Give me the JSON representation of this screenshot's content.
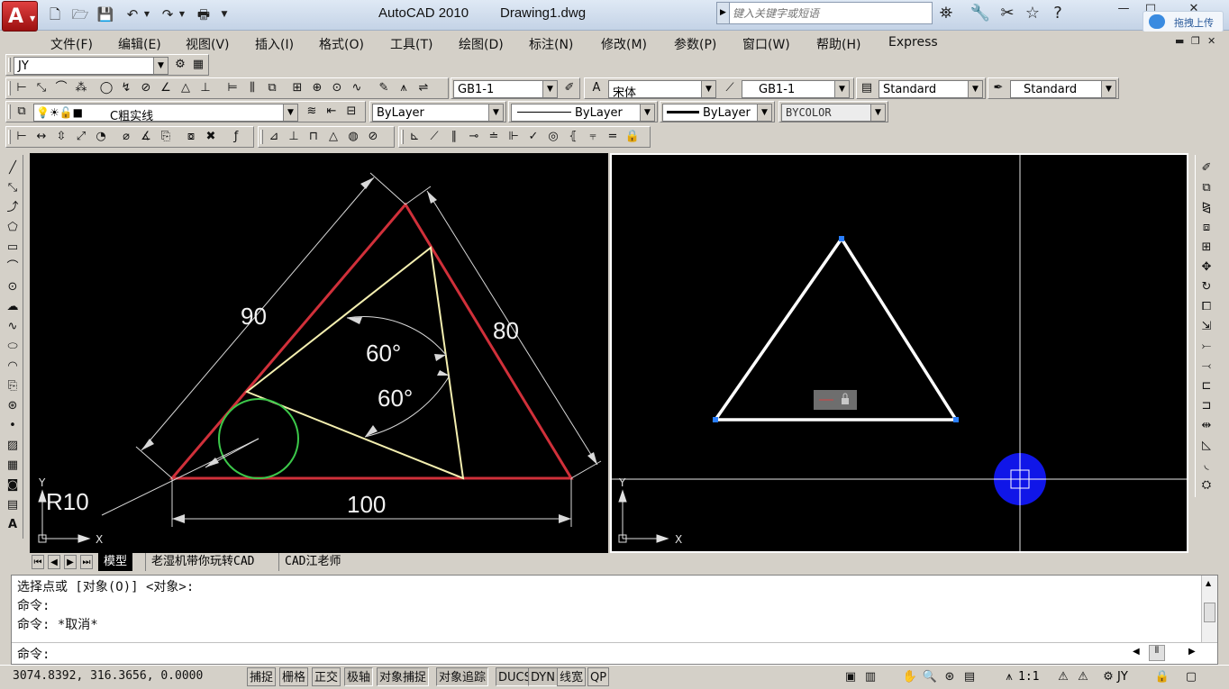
{
  "title_bar": {
    "app_name": "AutoCAD 2010",
    "document": "Drawing1.dwg",
    "search_placeholder": "键入关键字或短语",
    "upload_label": "拖拽上传"
  },
  "menu": [
    "文件(F)",
    "编辑(E)",
    "视图(V)",
    "插入(I)",
    "格式(O)",
    "工具(T)",
    "绘图(D)",
    "标注(N)",
    "修改(M)",
    "参数(P)",
    "窗口(W)",
    "帮助(H)",
    "Express"
  ],
  "workspace_combo": "JY",
  "styles_toolbar": {
    "dim_style": "GB1-1",
    "text_style": "宋体",
    "table_style": "GB1-1",
    "multileader_style": "Standard",
    "plot_style": "Standard"
  },
  "layers_toolbar": {
    "layer": "C粗实线",
    "color": "ByLayer",
    "linetype": "ByLayer",
    "lineweight": "ByLayer",
    "plotstyle": "BYCOLOR"
  },
  "left_drawing": {
    "dim_90": "90",
    "dim_80": "80",
    "dim_100": "100",
    "angle_1": "60°",
    "angle_2": "60°",
    "radius": "R10",
    "ucs_y": "Y",
    "ucs_x": "X"
  },
  "right_drawing": {
    "ucs_y": "Y",
    "ucs_x": "X"
  },
  "tabs": {
    "model": "模型",
    "layout1": "老湿机带你玩转CAD",
    "layout2": "CAD江老师"
  },
  "command": {
    "history": [
      "选择点或 [对象(O)] <对象>:",
      "命令:",
      "命令: *取消*"
    ],
    "prompt": "命令:"
  },
  "status": {
    "coordinates": "3074.8392, 316.3656, 0.0000",
    "toggles": [
      "捕捉",
      "栅格",
      "正交",
      "极轴",
      "对象捕捉",
      "对象追踪",
      "DUCS",
      "DYN",
      "线宽",
      "QP"
    ],
    "annotation_scale": "1:1",
    "workspace": "JY"
  }
}
